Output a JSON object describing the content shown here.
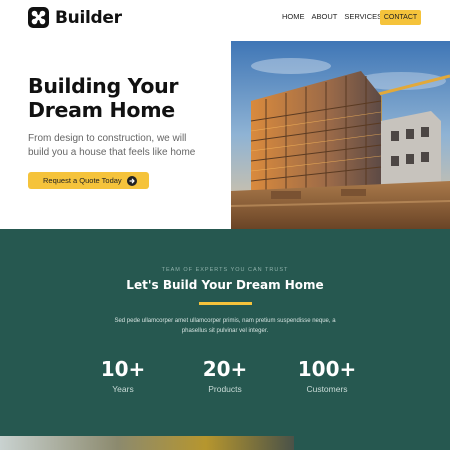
{
  "brand": {
    "name": "Builder"
  },
  "nav": {
    "links": [
      "HOME",
      "ABOUT",
      "SERVICES"
    ],
    "contact_label": "CONTACT"
  },
  "hero": {
    "title_line1": "Building Your",
    "title_line2": "Dream Home",
    "subtitle": "From design to construction, we will build you a house that feels like home",
    "cta_label": "Request a Quote Today"
  },
  "about": {
    "eyebrow": "TEAM OF EXPERTS YOU CAN TRUST",
    "title": "Let's Build Your Dream Home",
    "text": "Sed pede ullamcorper amet ullamcorper primis, nam pretium suspendisse neque, a phasellus sit pulvinar vel integer.",
    "stats": [
      {
        "value": "10+",
        "label": "Years"
      },
      {
        "value": "20+",
        "label": "Products"
      },
      {
        "value": "100+",
        "label": "Customers"
      }
    ]
  },
  "colors": {
    "accent": "#f5c33b",
    "band": "#265850",
    "text": "#111111"
  },
  "icons": {
    "logo": "x-mark-icon",
    "cta": "arrow-right-icon"
  }
}
